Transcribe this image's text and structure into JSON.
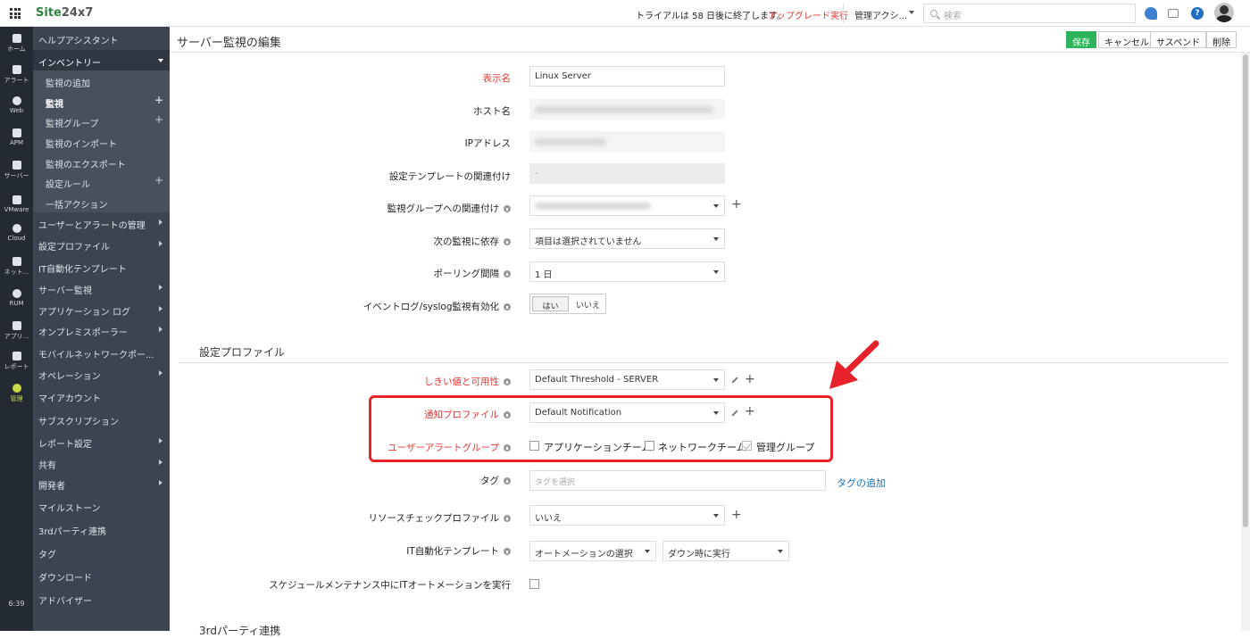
{
  "topbar": {
    "logo_prefix": "Site",
    "logo_suffix": "24x7",
    "trial_text": "トライアルは 58 日後に終了します。",
    "upgrade_link": "アップグレード実行",
    "admin_label": "管理アクシ...",
    "search_placeholder": "検索"
  },
  "rail": {
    "items": [
      "ホーム",
      "アラート",
      "Web",
      "APM",
      "サーバー",
      "VMware",
      "Cloud",
      "ネット...",
      "RUM",
      "アプリ...",
      "レポート",
      "管理"
    ],
    "time": "6:39"
  },
  "nav": {
    "help": "ヘルプアシスタント",
    "inventory": "インベントリー",
    "inventory_items": [
      "監視の追加",
      "監視",
      "監視グループ",
      "監視のインポート",
      "監視のエクスポート",
      "設定ルール",
      "一括アクション"
    ],
    "items": [
      "ユーザーとアラートの管理",
      "設定プロファイル",
      "IT自動化テンプレート",
      "サーバー監視",
      "アプリケーション ログ",
      "オンプレミスポーラー",
      "モバイルネットワークポー...",
      "オペレーション",
      "マイアカウント",
      "サブスクリプション",
      "レポート設定",
      "共有",
      "開発者",
      "マイルストーン",
      "3rdパーティ連携",
      "タグ",
      "ダウンロード",
      "アドバイザー"
    ]
  },
  "header": {
    "title": "サーバー監視の編集",
    "save": "保存",
    "cancel": "キャンセル",
    "suspend": "サスペンド",
    "delete": "削除"
  },
  "form": {
    "display_name_label": "表示名",
    "display_name_value": "Linux Server",
    "host_label": "ホスト名",
    "ip_label": "IPアドレス",
    "template_label": "設定テンプレートの関連付け",
    "template_value": "-",
    "group_label": "監視グループへの関連付け",
    "depend_label": "次の監視に依存",
    "depend_value": "項目は選択されていません",
    "polling_label": "ポーリング間隔",
    "polling_value": "1 日",
    "eventlog_label": "イベントログ/syslog監視有効化",
    "eventlog_yes": "はい",
    "eventlog_no": "いいえ"
  },
  "profiles": {
    "section_title": "設定プロファイル",
    "threshold_label": "しきい値と可用性",
    "threshold_value": "Default Threshold - SERVER",
    "notification_label": "通知プロファイル",
    "notification_value": "Default Notification",
    "user_alert_label": "ユーザーアラートグループ",
    "groups": [
      {
        "label": "アプリケーションチーム",
        "checked": false
      },
      {
        "label": "ネットワークチーム",
        "checked": false
      },
      {
        "label": "管理グループ",
        "checked": true
      }
    ],
    "tag_label": "タグ",
    "tag_placeholder": "タグを選択",
    "tag_add": "タグの追加",
    "resource_label": "リソースチェックプロファイル",
    "resource_value": "いいえ",
    "it_auto_label": "IT自動化テンプレート",
    "it_auto_value": "オートメーションの選択",
    "it_auto_when": "ダウン時に実行",
    "maintenance_label": "スケジュールメンテナンス中にITオートメーションを実行",
    "next_section": "3rdパーティ連携"
  },
  "colors": {
    "accent_green": "#2db45a",
    "required_red": "#e53935",
    "highlight_red": "#e8222a",
    "link_blue": "#1a73b8",
    "rail_bg": "#242a31",
    "nav_bg": "#3b4450"
  }
}
